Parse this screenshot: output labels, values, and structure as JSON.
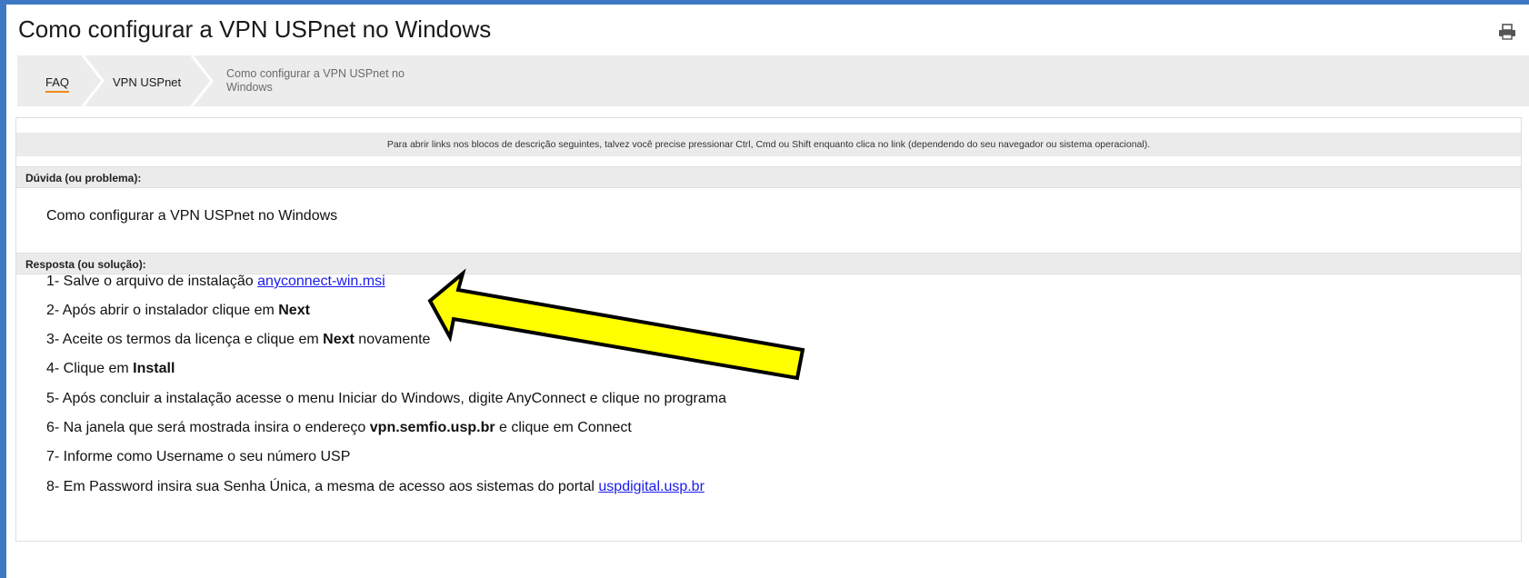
{
  "page": {
    "title": "Como configurar a VPN USPnet no Windows",
    "print_icon": "print-icon"
  },
  "breadcrumb": {
    "items": [
      "FAQ",
      "VPN USPnet",
      "Como configurar a VPN USPnet no Windows"
    ]
  },
  "notice": "Para abrir links nos blocos de descrição seguintes, talvez você precise pressionar Ctrl, Cmd ou Shift enquanto clica no link (dependendo do seu navegador ou sistema operacional).",
  "question": {
    "label": "Dúvida (ou problema):",
    "text": "Como configurar a VPN USPnet no Windows"
  },
  "answer": {
    "label": "Resposta (ou solução):",
    "steps": [
      {
        "pre": "1- Salve o arquivo de instalação ",
        "link": "anyconnect-win.msi"
      },
      {
        "pre": "2- Após abrir o instalador clique em ",
        "bold": "Next"
      },
      {
        "pre": "3- Aceite os termos da licença e clique em ",
        "bold": "Next",
        "post": " novamente"
      },
      {
        "pre": "4- Clique em ",
        "bold": "Install"
      },
      {
        "pre": "5- Após concluir a instalação acesse o menu Iniciar do Windows, digite AnyConnect e clique no programa"
      },
      {
        "pre": "6- Na janela que será mostrada insira o endereço ",
        "bold": "vpn.semfio.usp.br",
        "post": " e clique em Connect"
      },
      {
        "pre": "7- Informe como Username o seu número USP"
      },
      {
        "pre": "8- Em Password insira sua Senha Única, a mesma de acesso aos sistemas do portal ",
        "link": "uspdigital.usp.br"
      }
    ]
  },
  "annotation": {
    "arrow_color": "#ffff00",
    "arrow_outline": "#000000"
  },
  "colors": {
    "accent": "#f08a1a",
    "frame_blue": "#3f78c2",
    "link": "#1a1aee"
  }
}
